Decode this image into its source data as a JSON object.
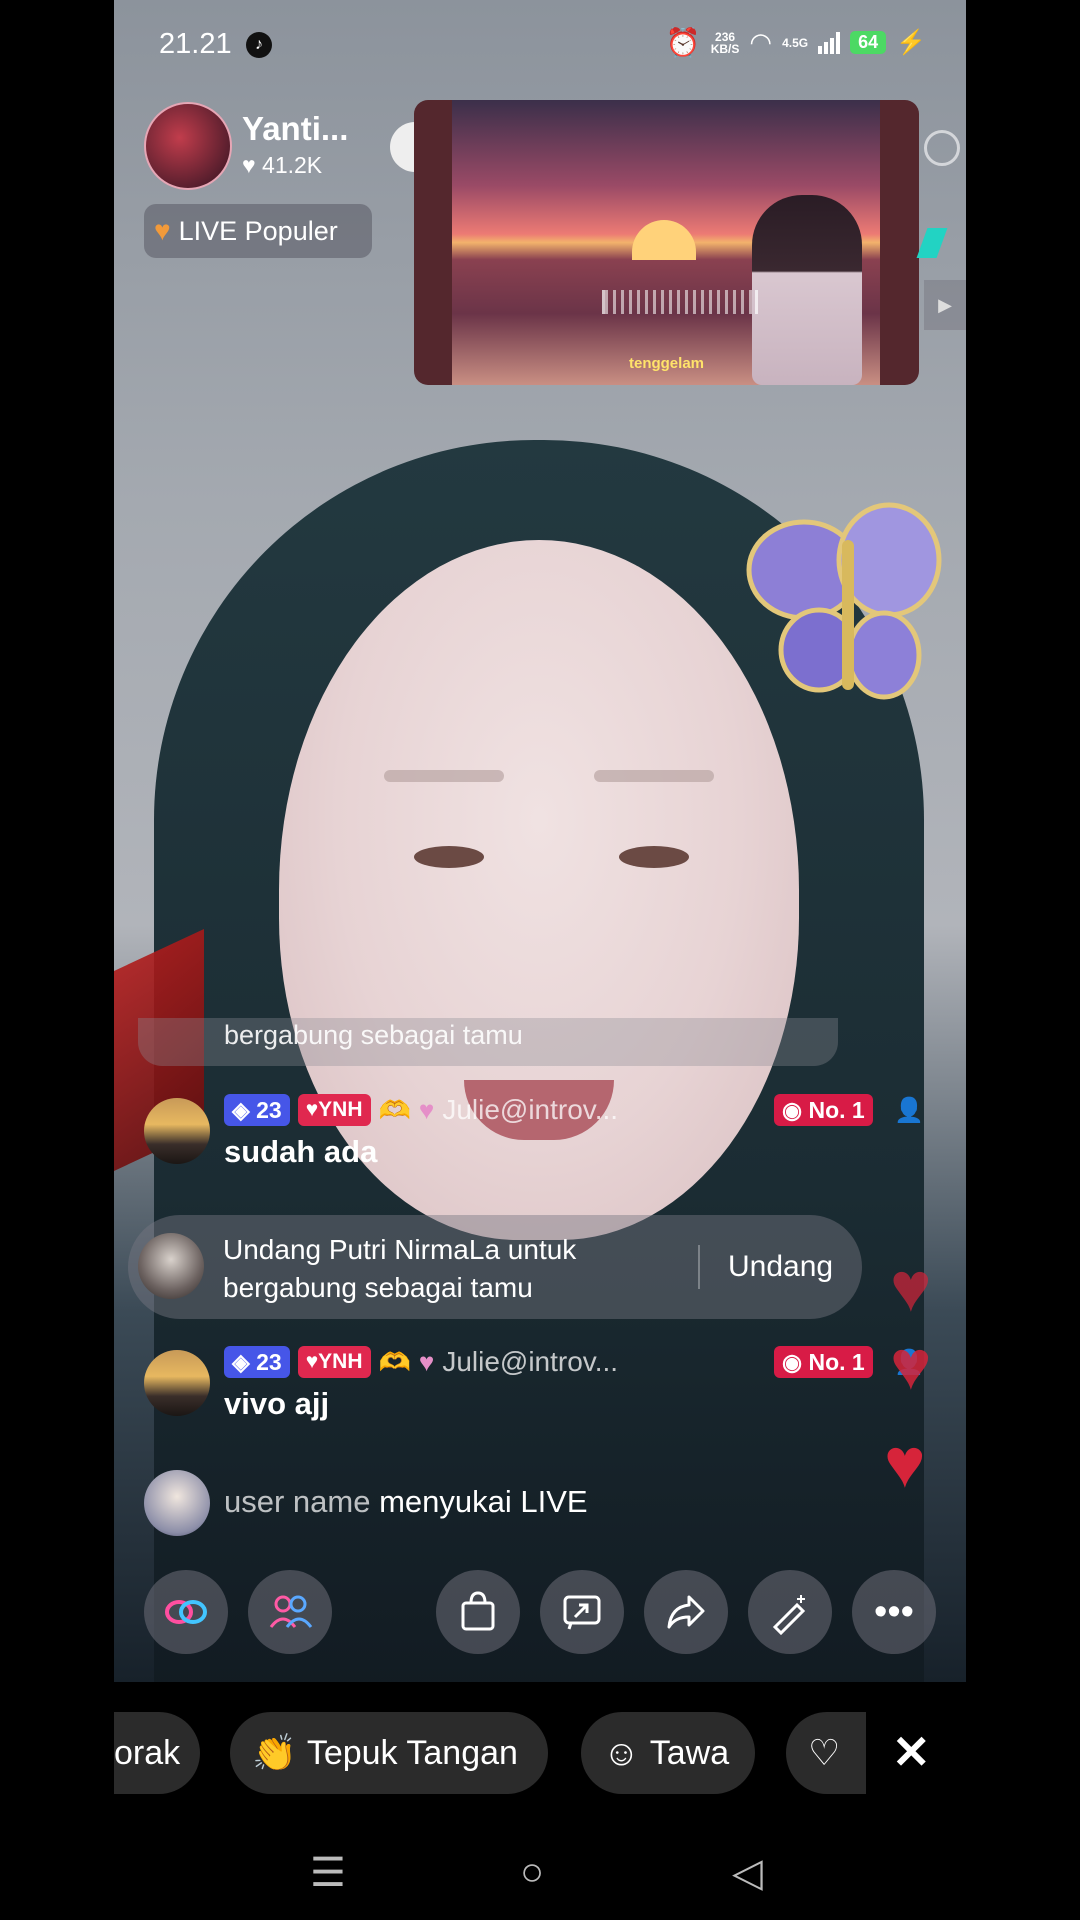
{
  "status_bar": {
    "time": "21.21",
    "net_speed": "236\nKB/S",
    "network_type": "4.5G",
    "battery": "64",
    "icons": [
      "tiktok-icon",
      "alarm-icon",
      "wifi-icon",
      "signal-icon",
      "battery-icon",
      "charging-icon"
    ]
  },
  "host": {
    "name": "Yanti...",
    "likes": "41.2K",
    "badge_label": "LIVE Populer"
  },
  "music_card": {
    "title": "tenggelam"
  },
  "comments": {
    "partial_text": "bergabung sebagai tamu",
    "items": [
      {
        "level": "23",
        "fan_badge": "YNH",
        "username": "Julie@introv...",
        "rank": "No. 1",
        "message": "sudah ada"
      },
      {
        "level": "23",
        "fan_badge": "YNH",
        "username": "Julie@introv...",
        "rank": "No. 1",
        "message": "vivo ajj"
      }
    ],
    "invite": {
      "text_line1": "Undang Putri NirmaLa untuk",
      "text_line2": "bergabung sebagai tamu",
      "button": "Undang"
    },
    "join": {
      "user": "user name",
      "action": "menyukai LIVE"
    }
  },
  "actions": [
    "link-icon",
    "guests-icon",
    "shop-bag-icon",
    "share-screen-icon",
    "share-icon",
    "effects-wand-icon",
    "more-icon"
  ],
  "reactions": {
    "partial": "orak",
    "clap": "Tepuk Tangan",
    "laugh": "Tawa"
  },
  "colors": {
    "live_red": "#d81b46",
    "level_blue": "#4656e8",
    "heart_red": "#d6243a",
    "music_title": "#ffe36a"
  }
}
